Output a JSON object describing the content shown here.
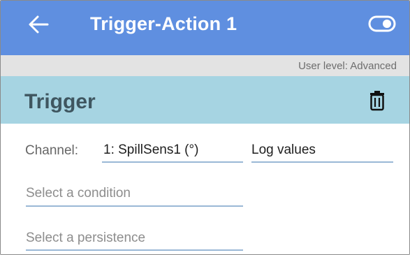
{
  "appbar": {
    "title": "Trigger-Action 1",
    "back_icon": "arrow-left-icon",
    "toggle_icon": "toggle-on-icon",
    "color": "#5f8fe0"
  },
  "userbar": {
    "text": "User level: Advanced"
  },
  "trigger": {
    "heading": "Trigger",
    "delete_icon": "trash-icon",
    "color": "#a6d4e2",
    "channel_label": "Channel:",
    "channel_value": "1: SpillSens1 (°)",
    "mode_value": "Log values",
    "condition_placeholder": "Select a condition",
    "persistence_placeholder": "Select a persistence"
  }
}
